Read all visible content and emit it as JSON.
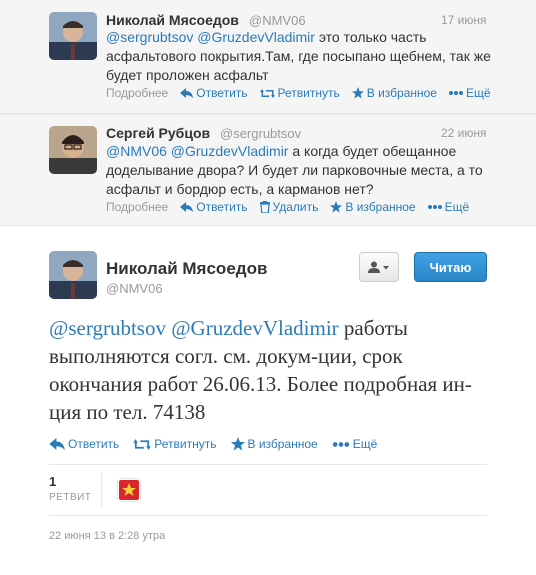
{
  "tweets": [
    {
      "name": "Николай Мясоедов",
      "handle": "@NMV06",
      "date": "17 июня",
      "mentions": "@sergrubtsov @GruzdevVladimir",
      "text": "  это только часть асфальтового покрытия.Там, где посыпано щебнем, так же будет проложен асфальт",
      "more_label": "Подробнее",
      "reply_label": "Ответить",
      "retweet_label": "Ретвитнуть",
      "favorite_label": "В избранное",
      "ellipsis_label": "Ещё"
    },
    {
      "name": "Сергей Рубцов",
      "handle": "@sergrubtsov",
      "date": "22 июня",
      "mentions": "@NMV06 @GruzdevVladimir",
      "text": " а когда будет обещанное доделывание двора? И будет ли парковочные места, а то асфальт и бордюр есть, а карманов нет?",
      "more_label": "Подробнее",
      "reply_label": "Ответить",
      "delete_label": "Удалить",
      "favorite_label": "В избранное",
      "ellipsis_label": "Ещё"
    }
  ],
  "main_tweet": {
    "name": "Николай Мясоедов",
    "handle": "@NMV06",
    "follow_label": "Читаю",
    "mentions": "@sergrubtsov @GruzdevVladimir",
    "text": " работы выполняются согл. см. докум-ции, срок окончания работ 26.06.13. Более подробная ин-ция по тел. 74138",
    "reply_label": "Ответить",
    "retweet_label": "Ретвитнуть",
    "favorite_label": "В избранное",
    "ellipsis_label": "Ещё",
    "retweet_count": "1",
    "retweet_count_label": "РЕТВИТ",
    "timestamp": "22 июня 13 в 2:28 утра"
  },
  "colors": {
    "link": "#2b7bb9",
    "button": "#2a86c9",
    "muted": "#999999"
  }
}
